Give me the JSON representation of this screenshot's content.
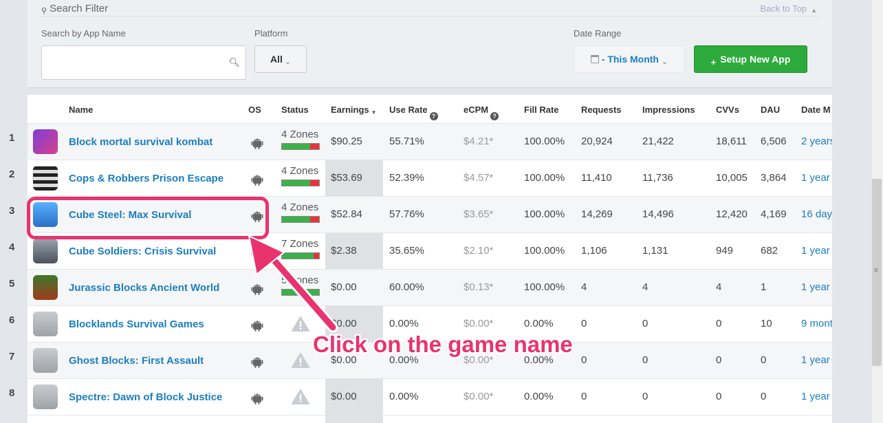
{
  "filter": {
    "title": "Search Filter",
    "back_to_top": "Back to Top",
    "search_label": "Search by App Name",
    "search_value": "",
    "platform_label": "Platform",
    "platform_value": "All",
    "date_label": "Date Range",
    "date_value": "- This Month",
    "setup_button": "Setup New App"
  },
  "columns": [
    "Name",
    "OS",
    "Status",
    "Earnings",
    "Use Rate",
    "eCPM",
    "Fill Rate",
    "Requests",
    "Impressions",
    "CVVs",
    "DAU",
    "Date M"
  ],
  "rows": [
    {
      "num": "1",
      "name": "Block mortal survival kombat",
      "zones": "4 Zones",
      "zones_green": 0.75,
      "earnings": "$90.25",
      "use_rate": "55.71%",
      "ecpm": "$4.21*",
      "fill_rate": "100.00%",
      "requests": "20,924",
      "impressions": "21,422",
      "cvvs": "18,611",
      "dau": "6,506",
      "date": "2 years"
    },
    {
      "num": "2",
      "name": "Cops & Robbers Prison Escape",
      "zones": "4 Zones",
      "zones_green": 0.75,
      "earnings": "$53.69",
      "use_rate": "52.39%",
      "ecpm": "$4.57*",
      "fill_rate": "100.00%",
      "requests": "11,410",
      "impressions": "11,736",
      "cvvs": "10,005",
      "dau": "3,864",
      "date": "1 year a"
    },
    {
      "num": "3",
      "name": "Cube Steel: Max Survival",
      "zones": "4 Zones",
      "zones_green": 0.75,
      "earnings": "$52.84",
      "use_rate": "57.76%",
      "ecpm": "$3.65*",
      "fill_rate": "100.00%",
      "requests": "14,269",
      "impressions": "14,496",
      "cvvs": "12,420",
      "dau": "4,169",
      "date": "16 days"
    },
    {
      "num": "4",
      "name": "Cube Soldiers: Crisis Survival",
      "zones": "7 Zones",
      "zones_green": 0.85,
      "earnings": "$2.38",
      "use_rate": "35.65%",
      "ecpm": "$2.10*",
      "fill_rate": "100.00%",
      "requests": "1,106",
      "impressions": "1,131",
      "cvvs": "949",
      "dau": "682",
      "date": "1 year a"
    },
    {
      "num": "5",
      "name": "Jurassic Blocks Ancient World",
      "zones": "5 Zones",
      "zones_green": 1.0,
      "earnings": "$0.00",
      "use_rate": "60.00%",
      "ecpm": "$0.13*",
      "fill_rate": "100.00%",
      "requests": "4",
      "impressions": "4",
      "cvvs": "4",
      "dau": "1",
      "date": "1 year a"
    },
    {
      "num": "6",
      "name": "Blocklands Survival Games",
      "zones": "",
      "zones_green": 0,
      "earnings": "$0.00",
      "use_rate": "0.00%",
      "ecpm": "$0.00*",
      "fill_rate": "0.00%",
      "requests": "0",
      "impressions": "0",
      "cvvs": "0",
      "dau": "10",
      "date": "9 mont"
    },
    {
      "num": "7",
      "name": "Ghost Blocks: First Assault",
      "zones": "",
      "zones_green": 0,
      "earnings": "$0.00",
      "use_rate": "0.00%",
      "ecpm": "$0.00*",
      "fill_rate": "0.00%",
      "requests": "0",
      "impressions": "0",
      "cvvs": "0",
      "dau": "0",
      "date": "1 year a"
    },
    {
      "num": "8",
      "name": "Spectre: Dawn of Block Justice",
      "zones": "",
      "zones_green": 0,
      "earnings": "$0.00",
      "use_rate": "0.00%",
      "ecpm": "$0.00*",
      "fill_rate": "0.00%",
      "requests": "0",
      "impressions": "0",
      "cvvs": "0",
      "dau": "0",
      "date": "1 year a"
    }
  ],
  "annotation": {
    "callout": "Click on the game name"
  },
  "colors": {
    "accent": "#1b7ec2",
    "setup_green": "#2daa3c",
    "annotation_pink": "#e8336e"
  }
}
